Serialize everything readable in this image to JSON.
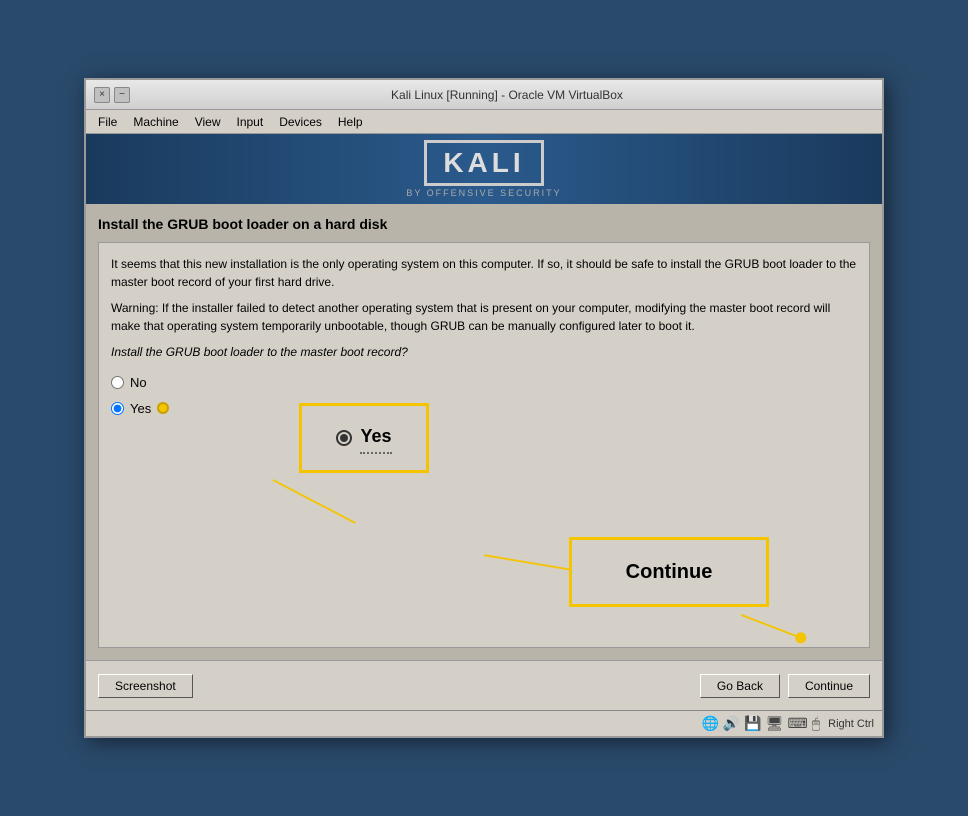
{
  "window": {
    "title": "Kali Linux [Running] - Oracle VM VirtualBox",
    "close_btn": "×",
    "minimize_btn": "−"
  },
  "menu": {
    "items": [
      "File",
      "Machine",
      "View",
      "Input",
      "Devices",
      "Help"
    ]
  },
  "kali": {
    "logo_text": "KALI",
    "subtitle": "BY OFFENSIVE SECURITY"
  },
  "installer": {
    "title": "Install the GRUB boot loader on a hard disk",
    "paragraph1": "It seems that this new installation is the only operating system on this computer. If so, it should be safe to install the GRUB boot loader to the master boot record of your first hard drive.",
    "paragraph2": "Warning: If the installer failed to detect another operating system that is present on your computer, modifying the master boot record will make that operating system temporarily unbootable, though GRUB can be manually configured later to boot it.",
    "question": "Install the GRUB boot loader to the master boot record?",
    "options": [
      {
        "label": "No",
        "value": "no",
        "checked": false
      },
      {
        "label": "Yes",
        "value": "yes",
        "checked": true
      }
    ]
  },
  "callout_yes": {
    "label": "Yes"
  },
  "callout_continue": {
    "label": "Continue"
  },
  "bottom": {
    "screenshot_btn": "Screenshot",
    "go_back_btn": "Go Back",
    "continue_btn": "Continue",
    "right_ctrl": "Right Ctrl"
  }
}
